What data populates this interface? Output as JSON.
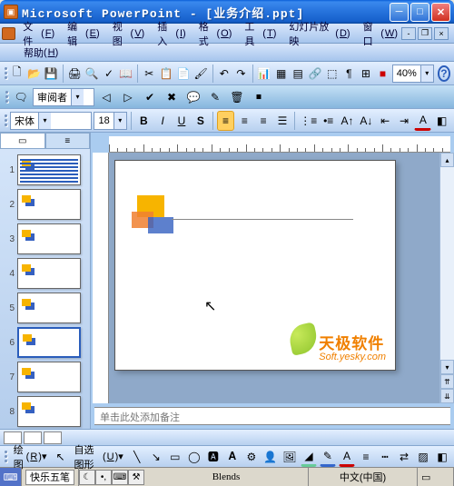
{
  "title": "Microsoft PowerPoint - [业务介绍.ppt]",
  "menus": {
    "file": "文件",
    "edit": "编辑",
    "view": "视图",
    "insert": "插入",
    "format": "格式",
    "tools": "工具",
    "slideshow": "幻灯片放映",
    "window": "窗口",
    "help": "帮助"
  },
  "menu_keys": {
    "file": "F",
    "edit": "E",
    "view": "V",
    "insert": "I",
    "format": "O",
    "tools": "T",
    "slideshow": "D",
    "window": "W",
    "help": "H"
  },
  "zoom": "40%",
  "font": {
    "name": "宋体",
    "size": "18"
  },
  "reviewing_label": "审阅者",
  "notes_placeholder": "单击此处添加备注",
  "drawing": {
    "menu": "绘图",
    "autoshapes": "自选图形"
  },
  "menu_keys2": {
    "draw": "R",
    "autoshapes": "U"
  },
  "ime": {
    "name": "快乐五笔",
    "design": "Blends",
    "lang": "中文(中国)"
  },
  "slide_numbers": [
    "1",
    "2",
    "3",
    "4",
    "5",
    "6",
    "7",
    "8"
  ],
  "selected_slide": 6,
  "watermark": {
    "brand": "天极软件",
    "url": "Soft.yesky.com"
  }
}
